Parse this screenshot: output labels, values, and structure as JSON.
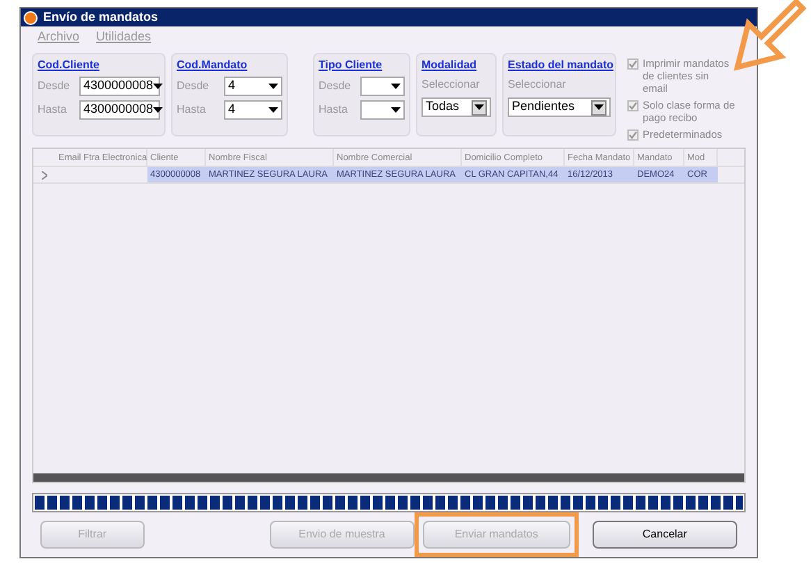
{
  "window": {
    "title": "Envío de mandatos"
  },
  "menu": [
    {
      "label": "Archivo",
      "disabled": true
    },
    {
      "label": "Utilidades",
      "disabled": true
    }
  ],
  "filters": [
    {
      "kind": "range",
      "title": "Cod.Cliente",
      "from_label": "Desde",
      "from_value": "4300000008",
      "to_label": "Hasta",
      "to_value": "4300000008"
    },
    {
      "kind": "range",
      "title": "Cod.Mandato",
      "from_label": "Desde",
      "from_value": "4",
      "to_label": "Hasta",
      "to_value": "4"
    },
    {
      "kind": "range",
      "title": "Tipo Cliente",
      "from_label": "Desde",
      "to_label": "Hasta"
    },
    {
      "kind": "select",
      "title": "Modalidad",
      "label": "Seleccionar",
      "value": "Todas"
    },
    {
      "kind": "select",
      "title": "Estado del mandato",
      "label": "Seleccionar",
      "value": "Pendientes"
    }
  ],
  "options": [
    {
      "label": "Imprimir mandatos de clientes sin email",
      "checked": true,
      "disabled": true
    },
    {
      "label": "Solo clase forma de pago recibo",
      "checked": true,
      "disabled": true
    },
    {
      "label": "Predeterminados",
      "checked": true,
      "disabled": true
    }
  ],
  "table": {
    "columns": [
      "Email Ftra Electronica",
      "Cliente",
      "Nombre Fiscal",
      "Nombre Comercial",
      "Domicilio Completo",
      "Fecha Mandato",
      "Mandato",
      "Mod"
    ],
    "rows": [
      {
        "selected": true,
        "cells": [
          "",
          "4300000008",
          "MARTINEZ SEGURA LAURA",
          "MARTINEZ SEGURA LAURA",
          "CL GRAN CAPITAN,44",
          "16/12/2013",
          "DEMO24",
          "COR"
        ]
      }
    ]
  },
  "progress": {
    "level": 1
  },
  "buttons": [
    {
      "label": "Filtrar",
      "disabled": true,
      "highlighted": false
    },
    {
      "label": "Envio de muestra",
      "disabled": true,
      "highlighted": false
    },
    {
      "label": "Enviar mandatos",
      "disabled": true,
      "highlighted": true
    },
    {
      "label": "Cancelar",
      "disabled": false,
      "highlighted": false
    }
  ]
}
